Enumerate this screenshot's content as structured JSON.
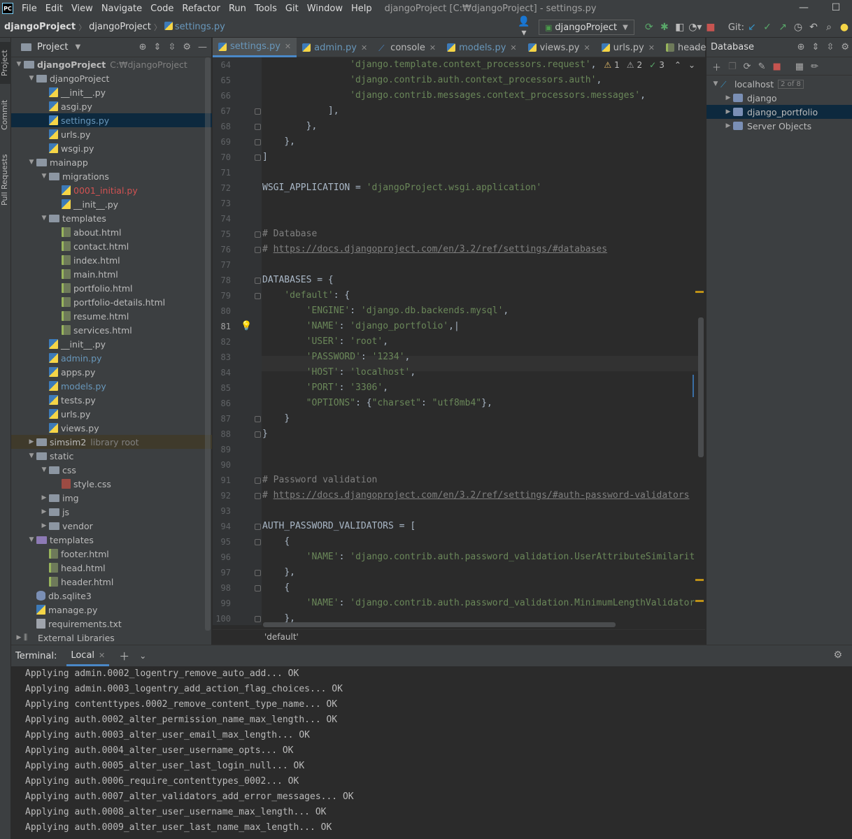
{
  "window": {
    "logo": "PC",
    "menu": [
      "File",
      "Edit",
      "View",
      "Navigate",
      "Code",
      "Refactor",
      "Run",
      "Tools",
      "Git",
      "Window",
      "Help"
    ],
    "title": "djangoProject [C:₩djangoProject] - settings.py"
  },
  "navbar": {
    "crumbs": [
      "djangoProject",
      "djangoProject",
      "settings.py"
    ],
    "run_config": "djangoProject",
    "git_label": "Git:"
  },
  "strip": {
    "project": "Project",
    "commit": "Commit",
    "pull": "Pull Requests"
  },
  "project": {
    "header": "Project",
    "tree": [
      {
        "depth": 0,
        "arrow": "v",
        "icon": "folder",
        "label": "djangoProject",
        "bold": true,
        "dim": "C:₩djangoProject"
      },
      {
        "depth": 1,
        "arrow": "v",
        "icon": "folder",
        "label": "djangoProject"
      },
      {
        "depth": 2,
        "icon": "py",
        "label": "__init__.py"
      },
      {
        "depth": 2,
        "icon": "py",
        "label": "asgi.py"
      },
      {
        "depth": 2,
        "icon": "py",
        "label": "settings.py",
        "selected": true,
        "color": "blue"
      },
      {
        "depth": 2,
        "icon": "py",
        "label": "urls.py"
      },
      {
        "depth": 2,
        "icon": "py",
        "label": "wsgi.py"
      },
      {
        "depth": 1,
        "arrow": "v",
        "icon": "folder",
        "label": "mainapp"
      },
      {
        "depth": 2,
        "arrow": "v",
        "icon": "folder",
        "label": "migrations"
      },
      {
        "depth": 3,
        "icon": "py",
        "label": "0001_initial.py",
        "color": "red"
      },
      {
        "depth": 3,
        "icon": "py",
        "label": "__init__.py"
      },
      {
        "depth": 2,
        "arrow": "v",
        "icon": "folder",
        "label": "templates"
      },
      {
        "depth": 3,
        "icon": "html",
        "label": "about.html"
      },
      {
        "depth": 3,
        "icon": "html",
        "label": "contact.html"
      },
      {
        "depth": 3,
        "icon": "html",
        "label": "index.html"
      },
      {
        "depth": 3,
        "icon": "html",
        "label": "main.html"
      },
      {
        "depth": 3,
        "icon": "html",
        "label": "portfolio.html"
      },
      {
        "depth": 3,
        "icon": "html",
        "label": "portfolio-details.html"
      },
      {
        "depth": 3,
        "icon": "html",
        "label": "resume.html"
      },
      {
        "depth": 3,
        "icon": "html",
        "label": "services.html"
      },
      {
        "depth": 2,
        "icon": "py",
        "label": "__init__.py"
      },
      {
        "depth": 2,
        "icon": "py",
        "label": "admin.py",
        "color": "blue"
      },
      {
        "depth": 2,
        "icon": "py",
        "label": "apps.py"
      },
      {
        "depth": 2,
        "icon": "py",
        "label": "models.py",
        "color": "blue"
      },
      {
        "depth": 2,
        "icon": "py",
        "label": "tests.py"
      },
      {
        "depth": 2,
        "icon": "py",
        "label": "urls.py"
      },
      {
        "depth": 2,
        "icon": "py",
        "label": "views.py"
      },
      {
        "depth": 1,
        "arrow": ">",
        "icon": "folder",
        "label": "simsim2",
        "dim": "library root",
        "lib": true
      },
      {
        "depth": 1,
        "arrow": "v",
        "icon": "folder",
        "label": "static"
      },
      {
        "depth": 2,
        "arrow": "v",
        "icon": "folder",
        "label": "css"
      },
      {
        "depth": 3,
        "icon": "css",
        "label": "style.css"
      },
      {
        "depth": 2,
        "arrow": ">",
        "icon": "folder",
        "label": "img"
      },
      {
        "depth": 2,
        "arrow": ">",
        "icon": "folder",
        "label": "js"
      },
      {
        "depth": 2,
        "arrow": ">",
        "icon": "folder",
        "label": "vendor"
      },
      {
        "depth": 1,
        "arrow": "v",
        "icon": "folder-purple",
        "label": "templates"
      },
      {
        "depth": 2,
        "icon": "html",
        "label": "footer.html"
      },
      {
        "depth": 2,
        "icon": "html",
        "label": "head.html"
      },
      {
        "depth": 2,
        "icon": "html",
        "label": "header.html"
      },
      {
        "depth": 1,
        "icon": "db",
        "label": "db.sqlite3"
      },
      {
        "depth": 1,
        "icon": "py",
        "label": "manage.py"
      },
      {
        "depth": 1,
        "icon": "txt",
        "label": "requirements.txt"
      },
      {
        "depth": 0,
        "arrow": ">",
        "icon": "lib",
        "label": "External Libraries"
      }
    ]
  },
  "editor": {
    "tabs": [
      {
        "label": "settings.py",
        "icon": "py",
        "active": true,
        "close": true
      },
      {
        "label": "admin.py",
        "icon": "py",
        "close": true,
        "blue": true
      },
      {
        "label": "console",
        "icon": "console",
        "close": true
      },
      {
        "label": "models.py",
        "icon": "py",
        "close": true,
        "blue": true
      },
      {
        "label": "views.py",
        "icon": "py",
        "close": true
      },
      {
        "label": "urls.py",
        "icon": "py",
        "close": true
      },
      {
        "label": "header.html",
        "icon": "html"
      }
    ],
    "inspections": {
      "warnings": "1",
      "weak": "2",
      "ok": "3"
    },
    "current_line": 81,
    "lines": [
      {
        "n": 64,
        "indent": 16,
        "parts": [
          [
            "s",
            "'django.template.context_processors.request'"
          ],
          [
            "p",
            ","
          ]
        ]
      },
      {
        "n": 65,
        "indent": 16,
        "parts": [
          [
            "s",
            "'django.contrib.auth.context_processors.auth'"
          ],
          [
            "p",
            ","
          ]
        ]
      },
      {
        "n": 66,
        "indent": 16,
        "parts": [
          [
            "s",
            "'django.contrib.messages.context_processors.messages'"
          ],
          [
            "p",
            ","
          ]
        ]
      },
      {
        "n": 67,
        "indent": 12,
        "fold": true,
        "parts": [
          [
            "p",
            "],"
          ]
        ]
      },
      {
        "n": 68,
        "indent": 8,
        "fold": true,
        "parts": [
          [
            "p",
            "},"
          ]
        ]
      },
      {
        "n": 69,
        "indent": 4,
        "fold": true,
        "parts": [
          [
            "p",
            "},"
          ]
        ]
      },
      {
        "n": 70,
        "indent": 0,
        "fold": true,
        "parts": [
          [
            "p",
            "]"
          ]
        ]
      },
      {
        "n": 71,
        "indent": 0,
        "parts": []
      },
      {
        "n": 72,
        "indent": 0,
        "parts": [
          [
            "p",
            "WSGI_APPLICATION = "
          ],
          [
            "s",
            "'djangoProject.wsgi.application'"
          ]
        ]
      },
      {
        "n": 73,
        "indent": 0,
        "parts": []
      },
      {
        "n": 74,
        "indent": 0,
        "parts": []
      },
      {
        "n": 75,
        "indent": 0,
        "fold": true,
        "parts": [
          [
            "c",
            "# Database"
          ]
        ]
      },
      {
        "n": 76,
        "indent": 0,
        "fold": true,
        "parts": [
          [
            "c",
            "# "
          ],
          [
            "u",
            "https://docs.djangoproject.com/en/3.2/ref/settings/#databases"
          ]
        ]
      },
      {
        "n": 77,
        "indent": 0,
        "parts": []
      },
      {
        "n": 78,
        "indent": 0,
        "fold": true,
        "parts": [
          [
            "p",
            "DATABASES = {"
          ]
        ]
      },
      {
        "n": 79,
        "indent": 4,
        "fold": true,
        "parts": [
          [
            "s",
            "'default'"
          ],
          [
            "p",
            ": {"
          ]
        ]
      },
      {
        "n": 80,
        "indent": 8,
        "parts": [
          [
            "s",
            "'ENGINE'"
          ],
          [
            "p",
            ": "
          ],
          [
            "s",
            "'django.db.backends.mysql'"
          ],
          [
            "p",
            ","
          ]
        ]
      },
      {
        "n": 81,
        "indent": 8,
        "bulb": true,
        "parts": [
          [
            "s",
            "'NAME'"
          ],
          [
            "p",
            ": "
          ],
          [
            "s",
            "'django_portfolio'"
          ],
          [
            "p",
            ",|"
          ]
        ]
      },
      {
        "n": 82,
        "indent": 8,
        "parts": [
          [
            "s",
            "'USER'"
          ],
          [
            "p",
            ": "
          ],
          [
            "s",
            "'root'"
          ],
          [
            "p",
            ","
          ]
        ]
      },
      {
        "n": 83,
        "indent": 8,
        "parts": [
          [
            "s",
            "'PASSWORD'"
          ],
          [
            "p",
            ": "
          ],
          [
            "s",
            "'1234'"
          ],
          [
            "p",
            ","
          ]
        ]
      },
      {
        "n": 84,
        "indent": 8,
        "parts": [
          [
            "s",
            "'HOST'"
          ],
          [
            "p",
            ": "
          ],
          [
            "s",
            "'localhost'"
          ],
          [
            "p",
            ","
          ]
        ]
      },
      {
        "n": 85,
        "indent": 8,
        "parts": [
          [
            "s",
            "'PORT'"
          ],
          [
            "p",
            ": "
          ],
          [
            "s",
            "'3306'"
          ],
          [
            "p",
            ","
          ]
        ]
      },
      {
        "n": 86,
        "indent": 8,
        "parts": [
          [
            "s",
            "\"OPTIONS\""
          ],
          [
            "p",
            ": {"
          ],
          [
            "s",
            "\"charset\""
          ],
          [
            "p",
            ": "
          ],
          [
            "s",
            "\"utf8mb4\""
          ],
          [
            "p",
            "},"
          ]
        ]
      },
      {
        "n": 87,
        "indent": 4,
        "fold": true,
        "parts": [
          [
            "p",
            "}"
          ]
        ]
      },
      {
        "n": 88,
        "indent": 0,
        "fold": true,
        "parts": [
          [
            "p",
            "}"
          ]
        ]
      },
      {
        "n": 89,
        "indent": 0,
        "parts": []
      },
      {
        "n": 90,
        "indent": 0,
        "parts": []
      },
      {
        "n": 91,
        "indent": 0,
        "fold": true,
        "parts": [
          [
            "c",
            "# Password validation"
          ]
        ]
      },
      {
        "n": 92,
        "indent": 0,
        "fold": true,
        "parts": [
          [
            "c",
            "# "
          ],
          [
            "u",
            "https://docs.djangoproject.com/en/3.2/ref/settings/#auth-password-validators"
          ]
        ]
      },
      {
        "n": 93,
        "indent": 0,
        "parts": []
      },
      {
        "n": 94,
        "indent": 0,
        "fold": true,
        "parts": [
          [
            "p",
            "AUTH_PASSWORD_VALIDATORS = ["
          ]
        ]
      },
      {
        "n": 95,
        "indent": 4,
        "fold": true,
        "parts": [
          [
            "p",
            "{"
          ]
        ]
      },
      {
        "n": 96,
        "indent": 8,
        "parts": [
          [
            "s",
            "'NAME'"
          ],
          [
            "p",
            ": "
          ],
          [
            "s",
            "'django.contrib.auth.password_validation.UserAttributeSimilarit"
          ]
        ]
      },
      {
        "n": 97,
        "indent": 4,
        "fold": true,
        "parts": [
          [
            "p",
            "},"
          ]
        ]
      },
      {
        "n": 98,
        "indent": 4,
        "fold": true,
        "parts": [
          [
            "p",
            "{"
          ]
        ]
      },
      {
        "n": 99,
        "indent": 8,
        "parts": [
          [
            "s",
            "'NAME'"
          ],
          [
            "p",
            ": "
          ],
          [
            "s",
            "'django.contrib.auth.password_validation.MinimumLengthValidator"
          ]
        ]
      },
      {
        "n": 100,
        "indent": 4,
        "fold": true,
        "parts": [
          [
            "p",
            "},"
          ]
        ]
      }
    ],
    "breadcrumb": "'default'"
  },
  "database": {
    "header": "Database",
    "tree": [
      {
        "depth": 0,
        "arrow": "v",
        "label": "localhost",
        "badge": "2 of 8"
      },
      {
        "depth": 1,
        "arrow": ">",
        "label": "django"
      },
      {
        "depth": 1,
        "arrow": ">",
        "label": "django_portfolio",
        "selected": true
      },
      {
        "depth": 1,
        "arrow": ">",
        "label": "Server Objects"
      }
    ]
  },
  "terminal": {
    "label": "Terminal:",
    "tab": "Local",
    "lines": [
      "Applying admin.0002_logentry_remove_auto_add... OK",
      "Applying admin.0003_logentry_add_action_flag_choices... OK",
      "Applying contenttypes.0002_remove_content_type_name... OK",
      "Applying auth.0002_alter_permission_name_max_length... OK",
      "Applying auth.0003_alter_user_email_max_length... OK",
      "Applying auth.0004_alter_user_username_opts... OK",
      "Applying auth.0005_alter_user_last_login_null... OK",
      "Applying auth.0006_require_contenttypes_0002... OK",
      "Applying auth.0007_alter_validators_add_error_messages... OK",
      "Applying auth.0008_alter_user_username_max_length... OK",
      "Applying auth.0009_alter_user_last_name_max_length... OK"
    ]
  }
}
